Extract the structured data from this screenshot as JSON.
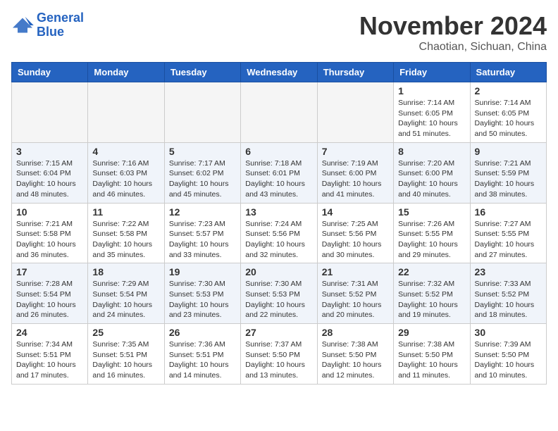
{
  "header": {
    "logo_line1": "General",
    "logo_line2": "Blue",
    "month": "November 2024",
    "location": "Chaotian, Sichuan, China"
  },
  "weekdays": [
    "Sunday",
    "Monday",
    "Tuesday",
    "Wednesday",
    "Thursday",
    "Friday",
    "Saturday"
  ],
  "weeks": [
    [
      {
        "day": "",
        "info": ""
      },
      {
        "day": "",
        "info": ""
      },
      {
        "day": "",
        "info": ""
      },
      {
        "day": "",
        "info": ""
      },
      {
        "day": "",
        "info": ""
      },
      {
        "day": "1",
        "info": "Sunrise: 7:14 AM\nSunset: 6:05 PM\nDaylight: 10 hours\nand 51 minutes."
      },
      {
        "day": "2",
        "info": "Sunrise: 7:14 AM\nSunset: 6:05 PM\nDaylight: 10 hours\nand 50 minutes."
      }
    ],
    [
      {
        "day": "3",
        "info": "Sunrise: 7:15 AM\nSunset: 6:04 PM\nDaylight: 10 hours\nand 48 minutes."
      },
      {
        "day": "4",
        "info": "Sunrise: 7:16 AM\nSunset: 6:03 PM\nDaylight: 10 hours\nand 46 minutes."
      },
      {
        "day": "5",
        "info": "Sunrise: 7:17 AM\nSunset: 6:02 PM\nDaylight: 10 hours\nand 45 minutes."
      },
      {
        "day": "6",
        "info": "Sunrise: 7:18 AM\nSunset: 6:01 PM\nDaylight: 10 hours\nand 43 minutes."
      },
      {
        "day": "7",
        "info": "Sunrise: 7:19 AM\nSunset: 6:00 PM\nDaylight: 10 hours\nand 41 minutes."
      },
      {
        "day": "8",
        "info": "Sunrise: 7:20 AM\nSunset: 6:00 PM\nDaylight: 10 hours\nand 40 minutes."
      },
      {
        "day": "9",
        "info": "Sunrise: 7:21 AM\nSunset: 5:59 PM\nDaylight: 10 hours\nand 38 minutes."
      }
    ],
    [
      {
        "day": "10",
        "info": "Sunrise: 7:21 AM\nSunset: 5:58 PM\nDaylight: 10 hours\nand 36 minutes."
      },
      {
        "day": "11",
        "info": "Sunrise: 7:22 AM\nSunset: 5:58 PM\nDaylight: 10 hours\nand 35 minutes."
      },
      {
        "day": "12",
        "info": "Sunrise: 7:23 AM\nSunset: 5:57 PM\nDaylight: 10 hours\nand 33 minutes."
      },
      {
        "day": "13",
        "info": "Sunrise: 7:24 AM\nSunset: 5:56 PM\nDaylight: 10 hours\nand 32 minutes."
      },
      {
        "day": "14",
        "info": "Sunrise: 7:25 AM\nSunset: 5:56 PM\nDaylight: 10 hours\nand 30 minutes."
      },
      {
        "day": "15",
        "info": "Sunrise: 7:26 AM\nSunset: 5:55 PM\nDaylight: 10 hours\nand 29 minutes."
      },
      {
        "day": "16",
        "info": "Sunrise: 7:27 AM\nSunset: 5:55 PM\nDaylight: 10 hours\nand 27 minutes."
      }
    ],
    [
      {
        "day": "17",
        "info": "Sunrise: 7:28 AM\nSunset: 5:54 PM\nDaylight: 10 hours\nand 26 minutes."
      },
      {
        "day": "18",
        "info": "Sunrise: 7:29 AM\nSunset: 5:54 PM\nDaylight: 10 hours\nand 24 minutes."
      },
      {
        "day": "19",
        "info": "Sunrise: 7:30 AM\nSunset: 5:53 PM\nDaylight: 10 hours\nand 23 minutes."
      },
      {
        "day": "20",
        "info": "Sunrise: 7:30 AM\nSunset: 5:53 PM\nDaylight: 10 hours\nand 22 minutes."
      },
      {
        "day": "21",
        "info": "Sunrise: 7:31 AM\nSunset: 5:52 PM\nDaylight: 10 hours\nand 20 minutes."
      },
      {
        "day": "22",
        "info": "Sunrise: 7:32 AM\nSunset: 5:52 PM\nDaylight: 10 hours\nand 19 minutes."
      },
      {
        "day": "23",
        "info": "Sunrise: 7:33 AM\nSunset: 5:52 PM\nDaylight: 10 hours\nand 18 minutes."
      }
    ],
    [
      {
        "day": "24",
        "info": "Sunrise: 7:34 AM\nSunset: 5:51 PM\nDaylight: 10 hours\nand 17 minutes."
      },
      {
        "day": "25",
        "info": "Sunrise: 7:35 AM\nSunset: 5:51 PM\nDaylight: 10 hours\nand 16 minutes."
      },
      {
        "day": "26",
        "info": "Sunrise: 7:36 AM\nSunset: 5:51 PM\nDaylight: 10 hours\nand 14 minutes."
      },
      {
        "day": "27",
        "info": "Sunrise: 7:37 AM\nSunset: 5:50 PM\nDaylight: 10 hours\nand 13 minutes."
      },
      {
        "day": "28",
        "info": "Sunrise: 7:38 AM\nSunset: 5:50 PM\nDaylight: 10 hours\nand 12 minutes."
      },
      {
        "day": "29",
        "info": "Sunrise: 7:38 AM\nSunset: 5:50 PM\nDaylight: 10 hours\nand 11 minutes."
      },
      {
        "day": "30",
        "info": "Sunrise: 7:39 AM\nSunset: 5:50 PM\nDaylight: 10 hours\nand 10 minutes."
      }
    ]
  ]
}
